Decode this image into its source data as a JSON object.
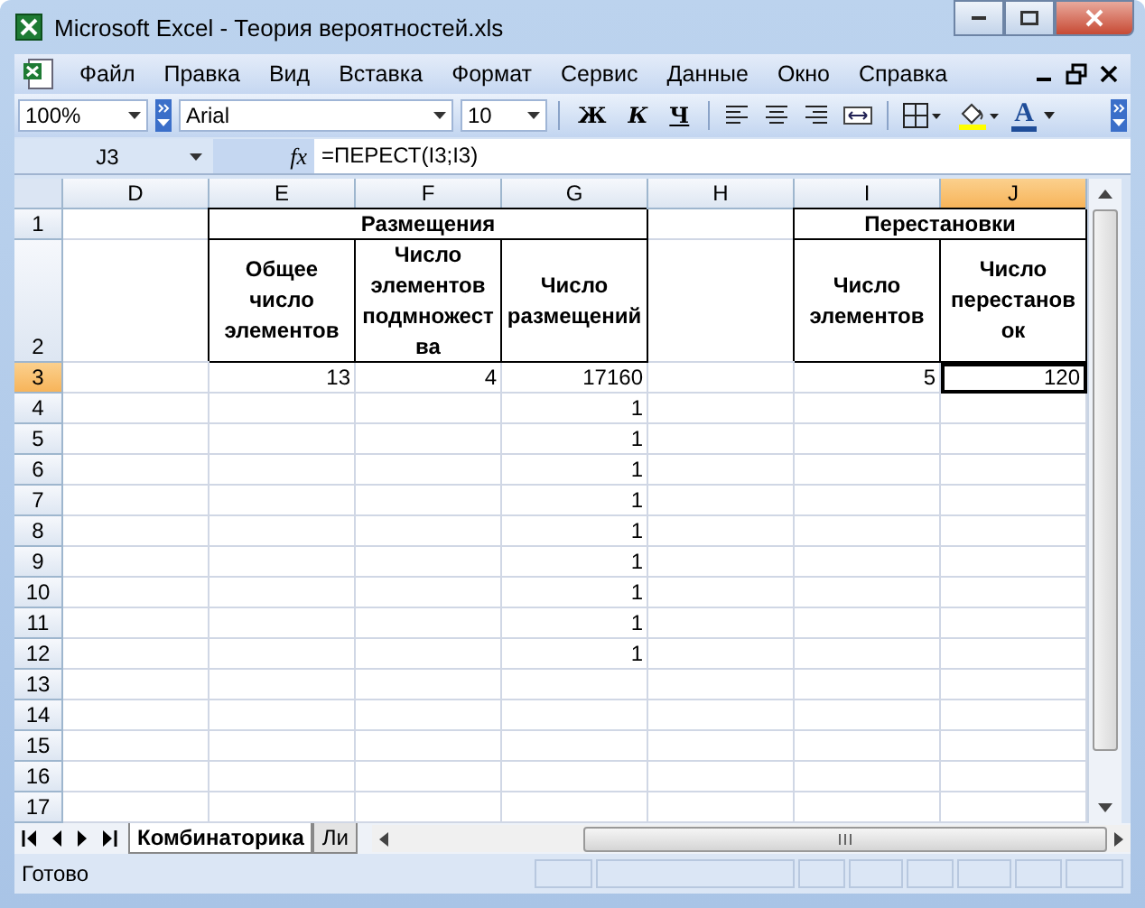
{
  "window": {
    "title": "Microsoft Excel - Теория вероятностей.xls"
  },
  "menu": [
    {
      "label": "Файл"
    },
    {
      "label": "Правка"
    },
    {
      "label": "Вид"
    },
    {
      "label": "Вставка"
    },
    {
      "label": "Формат"
    },
    {
      "label": "Сервис"
    },
    {
      "label": "Данные"
    },
    {
      "label": "Окно"
    },
    {
      "label": "Справка"
    }
  ],
  "toolbar": {
    "zoom": "100%",
    "font": "Arial",
    "font_size": "10",
    "bold": "Ж",
    "italic": "К",
    "underline": "Ч",
    "font_color": "A"
  },
  "formula_bar": {
    "name_box": "J3",
    "fx": "fx",
    "formula": "=ПЕРЕСТ(I3;I3)"
  },
  "sheet": {
    "columns": [
      {
        "label": "D",
        "selected": false
      },
      {
        "label": "E",
        "selected": false
      },
      {
        "label": "F",
        "selected": false
      },
      {
        "label": "G",
        "selected": false
      },
      {
        "label": "H",
        "selected": false
      },
      {
        "label": "I",
        "selected": false
      },
      {
        "label": "J",
        "selected": true
      }
    ],
    "rows": [
      {
        "label": "1",
        "selected": false,
        "cells": [
          {
            "kind": "empty"
          },
          {
            "kind": "group",
            "text": "Размещения",
            "colspan": 3
          },
          {
            "kind": "empty"
          },
          {
            "kind": "group",
            "text": "Перестановки",
            "colspan": 2
          }
        ]
      },
      {
        "label": "2",
        "selected": false,
        "cells": [
          {
            "kind": "empty"
          },
          {
            "kind": "header",
            "text": "Общее число элементов"
          },
          {
            "kind": "header",
            "text": "Число элементов подмножества"
          },
          {
            "kind": "header",
            "text": "Число размещений"
          },
          {
            "kind": "empty"
          },
          {
            "kind": "header",
            "text": "Число элементов"
          },
          {
            "kind": "header",
            "text": "Число перестановок"
          }
        ]
      },
      {
        "label": "3",
        "selected": true,
        "cells": [
          {
            "kind": "empty"
          },
          {
            "kind": "number",
            "text": "13"
          },
          {
            "kind": "number",
            "text": "4"
          },
          {
            "kind": "number",
            "text": "17160"
          },
          {
            "kind": "empty"
          },
          {
            "kind": "number",
            "text": "5"
          },
          {
            "kind": "number",
            "text": "120"
          }
        ]
      },
      {
        "label": "4",
        "selected": false,
        "cells": [
          {
            "kind": "empty"
          },
          {
            "kind": "empty"
          },
          {
            "kind": "empty"
          },
          {
            "kind": "number",
            "text": "1"
          },
          {
            "kind": "empty"
          },
          {
            "kind": "empty"
          },
          {
            "kind": "empty"
          }
        ]
      },
      {
        "label": "5",
        "selected": false,
        "cells": [
          {
            "kind": "empty"
          },
          {
            "kind": "empty"
          },
          {
            "kind": "empty"
          },
          {
            "kind": "number",
            "text": "1"
          },
          {
            "kind": "empty"
          },
          {
            "kind": "empty"
          },
          {
            "kind": "empty"
          }
        ]
      },
      {
        "label": "6",
        "selected": false,
        "cells": [
          {
            "kind": "empty"
          },
          {
            "kind": "empty"
          },
          {
            "kind": "empty"
          },
          {
            "kind": "number",
            "text": "1"
          },
          {
            "kind": "empty"
          },
          {
            "kind": "empty"
          },
          {
            "kind": "empty"
          }
        ]
      },
      {
        "label": "7",
        "selected": false,
        "cells": [
          {
            "kind": "empty"
          },
          {
            "kind": "empty"
          },
          {
            "kind": "empty"
          },
          {
            "kind": "number",
            "text": "1"
          },
          {
            "kind": "empty"
          },
          {
            "kind": "empty"
          },
          {
            "kind": "empty"
          }
        ]
      },
      {
        "label": "8",
        "selected": false,
        "cells": [
          {
            "kind": "empty"
          },
          {
            "kind": "empty"
          },
          {
            "kind": "empty"
          },
          {
            "kind": "number",
            "text": "1"
          },
          {
            "kind": "empty"
          },
          {
            "kind": "empty"
          },
          {
            "kind": "empty"
          }
        ]
      },
      {
        "label": "9",
        "selected": false,
        "cells": [
          {
            "kind": "empty"
          },
          {
            "kind": "empty"
          },
          {
            "kind": "empty"
          },
          {
            "kind": "number",
            "text": "1"
          },
          {
            "kind": "empty"
          },
          {
            "kind": "empty"
          },
          {
            "kind": "empty"
          }
        ]
      },
      {
        "label": "10",
        "selected": false,
        "cells": [
          {
            "kind": "empty"
          },
          {
            "kind": "empty"
          },
          {
            "kind": "empty"
          },
          {
            "kind": "number",
            "text": "1"
          },
          {
            "kind": "empty"
          },
          {
            "kind": "empty"
          },
          {
            "kind": "empty"
          }
        ]
      },
      {
        "label": "11",
        "selected": false,
        "cells": [
          {
            "kind": "empty"
          },
          {
            "kind": "empty"
          },
          {
            "kind": "empty"
          },
          {
            "kind": "number",
            "text": "1"
          },
          {
            "kind": "empty"
          },
          {
            "kind": "empty"
          },
          {
            "kind": "empty"
          }
        ]
      },
      {
        "label": "12",
        "selected": false,
        "cells": [
          {
            "kind": "empty"
          },
          {
            "kind": "empty"
          },
          {
            "kind": "empty"
          },
          {
            "kind": "number",
            "text": "1"
          },
          {
            "kind": "empty"
          },
          {
            "kind": "empty"
          },
          {
            "kind": "empty"
          }
        ]
      },
      {
        "label": "13",
        "selected": false,
        "cells": [
          {
            "kind": "empty"
          },
          {
            "kind": "empty"
          },
          {
            "kind": "empty"
          },
          {
            "kind": "empty"
          },
          {
            "kind": "empty"
          },
          {
            "kind": "empty"
          },
          {
            "kind": "empty"
          }
        ]
      },
      {
        "label": "14",
        "selected": false,
        "cells": [
          {
            "kind": "empty"
          },
          {
            "kind": "empty"
          },
          {
            "kind": "empty"
          },
          {
            "kind": "empty"
          },
          {
            "kind": "empty"
          },
          {
            "kind": "empty"
          },
          {
            "kind": "empty"
          }
        ]
      },
      {
        "label": "15",
        "selected": false,
        "cells": [
          {
            "kind": "empty"
          },
          {
            "kind": "empty"
          },
          {
            "kind": "empty"
          },
          {
            "kind": "empty"
          },
          {
            "kind": "empty"
          },
          {
            "kind": "empty"
          },
          {
            "kind": "empty"
          }
        ]
      },
      {
        "label": "16",
        "selected": false,
        "cells": [
          {
            "kind": "empty"
          },
          {
            "kind": "empty"
          },
          {
            "kind": "empty"
          },
          {
            "kind": "empty"
          },
          {
            "kind": "empty"
          },
          {
            "kind": "empty"
          },
          {
            "kind": "empty"
          }
        ]
      },
      {
        "label": "17",
        "selected": false,
        "cells": [
          {
            "kind": "empty"
          },
          {
            "kind": "empty"
          },
          {
            "kind": "empty"
          },
          {
            "kind": "empty"
          },
          {
            "kind": "empty"
          },
          {
            "kind": "empty"
          },
          {
            "kind": "empty"
          }
        ]
      }
    ]
  },
  "sheet_tabs": [
    {
      "label": "Комбинаторика",
      "selected": true
    },
    {
      "label": "Ли",
      "selected": false
    }
  ],
  "status_bar": {
    "text": "Готово"
  }
}
